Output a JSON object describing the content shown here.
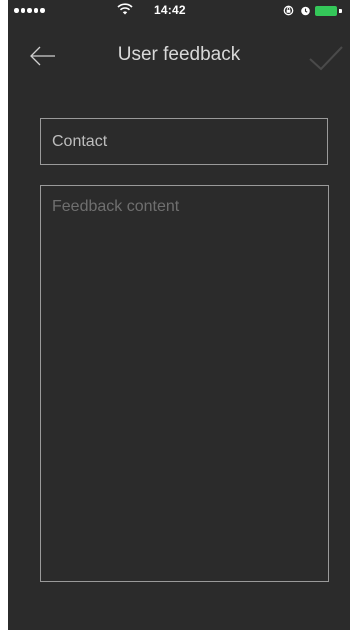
{
  "status_bar": {
    "time": "14:42",
    "signal_icon": "cellular-signal-dots-icon",
    "wifi_icon": "wifi-icon",
    "rotation_lock_icon": "rotation-lock-icon",
    "alarm_icon": "alarm-icon",
    "battery_icon": "battery-icon",
    "battery_color": "#34c759"
  },
  "nav": {
    "title": "User feedback",
    "back_icon": "back-arrow-icon",
    "confirm_icon": "checkmark-icon"
  },
  "form": {
    "contact_placeholder": "Contact",
    "contact_value": "",
    "feedback_placeholder": "Feedback content",
    "feedback_value": ""
  },
  "colors": {
    "background": "#2b2b2b",
    "border": "#9a9a9a",
    "title_text": "#d8d8d8"
  }
}
